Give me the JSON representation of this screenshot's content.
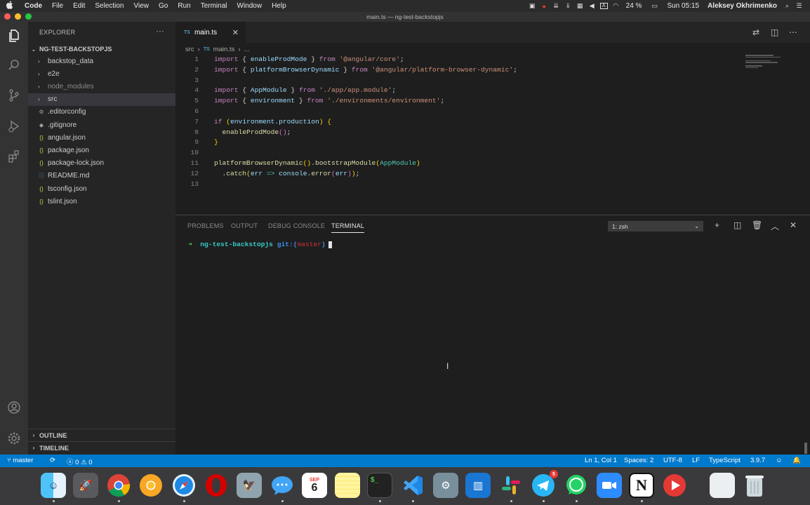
{
  "menubar": {
    "items": [
      "Code",
      "File",
      "Edit",
      "Selection",
      "View",
      "Go",
      "Run",
      "Terminal",
      "Window",
      "Help"
    ],
    "battery": "24 %",
    "clock": "Sun 05:15",
    "user": "Aleksey Okhrimenko",
    "status_icons": [
      "camera-icon",
      "chrome-record-icon",
      "download-icon",
      "download-2-icon",
      "grid-icon",
      "volume-icon",
      "input-method-icon",
      "wifi-icon",
      "battery-icon",
      "search-icon",
      "control-center-icon"
    ]
  },
  "window": {
    "title": "main.ts — ng-test-backstopjs"
  },
  "activity_bar": {
    "icons": [
      "explorer-icon",
      "search-icon",
      "source-control-icon",
      "run-debug-icon",
      "extensions-icon",
      "account-icon",
      "settings-icon"
    ]
  },
  "sidebar": {
    "header": "EXPLORER",
    "more": "···",
    "project": "NG-TEST-BACKSTOPJS",
    "tree": [
      {
        "label": "backstop_data",
        "type": "folder",
        "icon": "›"
      },
      {
        "label": "e2e",
        "type": "folder",
        "icon": "›"
      },
      {
        "label": "node_modules",
        "type": "folder-dim",
        "icon": "›"
      },
      {
        "label": "src",
        "type": "folder-selected",
        "icon": "›"
      },
      {
        "label": ".editorconfig",
        "type": "file",
        "icon": "⚙"
      },
      {
        "label": ".gitignore",
        "type": "file",
        "icon": "◆"
      },
      {
        "label": "angular.json",
        "type": "file",
        "icon": "{}"
      },
      {
        "label": "package.json",
        "type": "file",
        "icon": "{}"
      },
      {
        "label": "package-lock.json",
        "type": "file",
        "icon": "{}"
      },
      {
        "label": "README.md",
        "type": "file",
        "icon": "ⓘ"
      },
      {
        "label": "tsconfig.json",
        "type": "file",
        "icon": "{}"
      },
      {
        "label": "tslint.json",
        "type": "file",
        "icon": "{}"
      }
    ],
    "sections": [
      "OUTLINE",
      "TIMELINE"
    ]
  },
  "editor": {
    "tab": {
      "label": "main.ts",
      "lang": "TS"
    },
    "breadcrumbs": [
      "src",
      "›",
      "main.ts",
      "›",
      "..."
    ],
    "lines": [
      {
        "n": "1",
        "tokens": [
          [
            "k",
            "import"
          ],
          [
            "p",
            " { "
          ],
          [
            "v",
            "enableProdMode"
          ],
          [
            "p",
            " } "
          ],
          [
            "k",
            "from"
          ],
          [
            "p",
            " "
          ],
          [
            "s",
            "'@angular/core'"
          ],
          [
            "p",
            ";"
          ]
        ]
      },
      {
        "n": "2",
        "tokens": [
          [
            "k",
            "import"
          ],
          [
            "p",
            " { "
          ],
          [
            "v",
            "platformBrowserDynamic"
          ],
          [
            "p",
            " } "
          ],
          [
            "k",
            "from"
          ],
          [
            "p",
            " "
          ],
          [
            "s",
            "'@angular/platform-browser-dynamic'"
          ],
          [
            "p",
            ";"
          ]
        ]
      },
      {
        "n": "3",
        "tokens": []
      },
      {
        "n": "4",
        "tokens": [
          [
            "k",
            "import"
          ],
          [
            "p",
            " { "
          ],
          [
            "v",
            "AppModule"
          ],
          [
            "p",
            " } "
          ],
          [
            "k",
            "from"
          ],
          [
            "p",
            " "
          ],
          [
            "s",
            "'./app/app.module'"
          ],
          [
            "p",
            ";"
          ]
        ]
      },
      {
        "n": "5",
        "tokens": [
          [
            "k",
            "import"
          ],
          [
            "p",
            " { "
          ],
          [
            "v",
            "environment"
          ],
          [
            "p",
            " } "
          ],
          [
            "k",
            "from"
          ],
          [
            "p",
            " "
          ],
          [
            "s",
            "'./environments/environment'"
          ],
          [
            "p",
            ";"
          ]
        ]
      },
      {
        "n": "6",
        "tokens": []
      },
      {
        "n": "7",
        "tokens": [
          [
            "k",
            "if"
          ],
          [
            "p",
            " "
          ],
          [
            "b",
            "("
          ],
          [
            "v",
            "environment"
          ],
          [
            "p",
            "."
          ],
          [
            "v",
            "production"
          ],
          [
            "b",
            ")"
          ],
          [
            "p",
            " "
          ],
          [
            "b",
            "{"
          ]
        ]
      },
      {
        "n": "8",
        "tokens": [
          [
            "p",
            "  "
          ],
          [
            "f",
            "enableProdMode"
          ],
          [
            "b2",
            "()"
          ],
          [
            "p",
            ";"
          ]
        ]
      },
      {
        "n": "9",
        "tokens": [
          [
            "b",
            "}"
          ]
        ]
      },
      {
        "n": "10",
        "tokens": []
      },
      {
        "n": "11",
        "tokens": [
          [
            "f",
            "platformBrowserDynamic"
          ],
          [
            "b",
            "()"
          ],
          [
            "p",
            "."
          ],
          [
            "f",
            "bootstrapModule"
          ],
          [
            "b",
            "("
          ],
          [
            "c",
            "AppModule"
          ],
          [
            "b",
            ")"
          ]
        ]
      },
      {
        "n": "12",
        "tokens": [
          [
            "p",
            "  ."
          ],
          [
            "f",
            "catch"
          ],
          [
            "b",
            "("
          ],
          [
            "v",
            "err"
          ],
          [
            "p",
            " "
          ],
          [
            "c",
            "=>"
          ],
          [
            "p",
            " "
          ],
          [
            "v",
            "console"
          ],
          [
            "p",
            "."
          ],
          [
            "f",
            "error"
          ],
          [
            "b2",
            "("
          ],
          [
            "v",
            "err"
          ],
          [
            "b2",
            ")"
          ],
          [
            "b",
            ")"
          ],
          [
            "p",
            ";"
          ]
        ]
      },
      {
        "n": "13",
        "tokens": []
      }
    ]
  },
  "panel": {
    "tabs": [
      "PROBLEMS",
      "OUTPUT",
      "DEBUG CONSOLE",
      "TERMINAL"
    ],
    "active_tab": "TERMINAL",
    "terminal_select": "1: zsh",
    "prompt": {
      "arrow": "➜",
      "dir": "ng-test-backstopjs",
      "git": "git:(",
      "branch": "master",
      "git_close": ")"
    }
  },
  "statusbar": {
    "branch": "master",
    "errors": "0",
    "warnings": "0",
    "position": "Ln 1, Col 1",
    "spaces": "Spaces: 2",
    "encoding": "UTF-8",
    "eol": "LF",
    "language": "TypeScript",
    "version": "3.9.7"
  },
  "dock": {
    "calendar_month": "SEP",
    "calendar_day": "6",
    "telegram_badge": "5",
    "apps": [
      "finder-icon",
      "launchpad-icon",
      "chrome-icon",
      "chrome-canary-icon",
      "safari-icon",
      "opera-icon",
      "preview-icon",
      "messages-icon",
      "calendar-icon",
      "notes-icon",
      "terminal-icon",
      "vscode-icon",
      "system-preferences-icon",
      "keynote-icon",
      "slack-icon",
      "telegram-icon",
      "whatsapp-icon",
      "zoom-icon",
      "notion-icon",
      "youtube-icon",
      "documents-icon",
      "trash-icon"
    ]
  },
  "colors": {
    "accent": "#007acc",
    "activity_bar": "#333333",
    "sidebar": "#252526",
    "editor": "#1e1e1e"
  }
}
